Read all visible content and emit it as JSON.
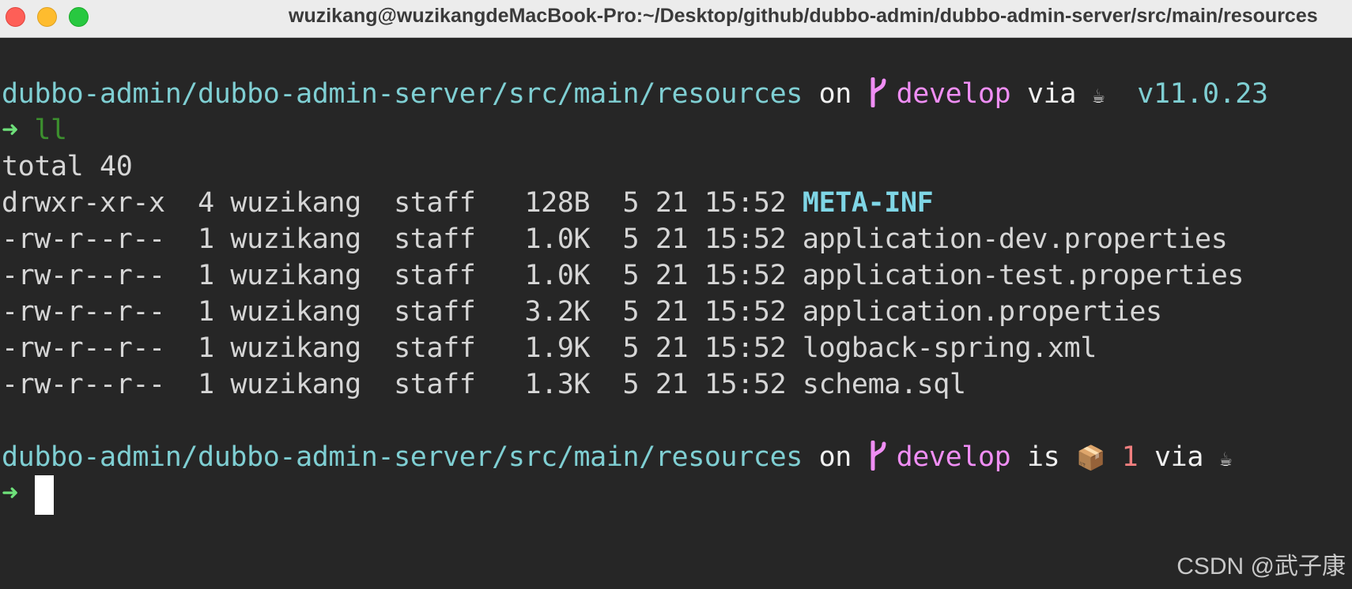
{
  "window": {
    "title": "wuzikang@wuzikangdeMacBook-Pro:~/Desktop/github/dubbo-admin/dubbo-admin-server/src/main/resources"
  },
  "colors": {
    "background": "#262626",
    "path": "#7fcfd3",
    "branch": "#f08ef5",
    "arrow": "#6ee07a",
    "file_count": "#f07f7f"
  },
  "prompt1": {
    "path": "dubbo-admin/dubbo-admin-server/src/main/resources",
    "on": " on ",
    "branch_icon": "git-branch-icon",
    "branch": "develop",
    "via": " via ",
    "java_icon": "coffee-icon",
    "java_glyph": "☕",
    "version": "  v11.0.23"
  },
  "command1": {
    "arrow": "➜",
    "text": "ll"
  },
  "output": {
    "total": "total 40",
    "rows": [
      {
        "perms": "drwxr-xr-x",
        "links": "4",
        "owner": "wuzikang",
        "group": "staff",
        "size": "128B",
        "month": "5",
        "day": "21",
        "time": "15:52",
        "name": "META-INF"
      },
      {
        "perms": "-rw-r--r--",
        "links": "1",
        "owner": "wuzikang",
        "group": "staff",
        "size": "1.0K",
        "month": "5",
        "day": "21",
        "time": "15:52",
        "name": "application-dev.properties"
      },
      {
        "perms": "-rw-r--r--",
        "links": "1",
        "owner": "wuzikang",
        "group": "staff",
        "size": "1.0K",
        "month": "5",
        "day": "21",
        "time": "15:52",
        "name": "application-test.properties"
      },
      {
        "perms": "-rw-r--r--",
        "links": "1",
        "owner": "wuzikang",
        "group": "staff",
        "size": "3.2K",
        "month": "5",
        "day": "21",
        "time": "15:52",
        "name": "application.properties"
      },
      {
        "perms": "-rw-r--r--",
        "links": "1",
        "owner": "wuzikang",
        "group": "staff",
        "size": "1.9K",
        "month": "5",
        "day": "21",
        "time": "15:52",
        "name": "logback-spring.xml"
      },
      {
        "perms": "-rw-r--r--",
        "links": "1",
        "owner": "wuzikang",
        "group": "staff",
        "size": "1.3K",
        "month": "5",
        "day": "21",
        "time": "15:52",
        "name": "schema.sql"
      }
    ]
  },
  "prompt2": {
    "path": "dubbo-admin/dubbo-admin-server/src/main/resources",
    "on": " on ",
    "branch_icon": "git-branch-icon",
    "branch": "develop",
    "is": " is ",
    "package_icon": "package-icon",
    "package_glyph": "📦",
    "count": " 1",
    "via": " via ",
    "java_icon": "coffee-icon",
    "java_glyph": "☕"
  },
  "command2": {
    "arrow": "➜",
    "text": ""
  },
  "watermark": "CSDN @武子康"
}
